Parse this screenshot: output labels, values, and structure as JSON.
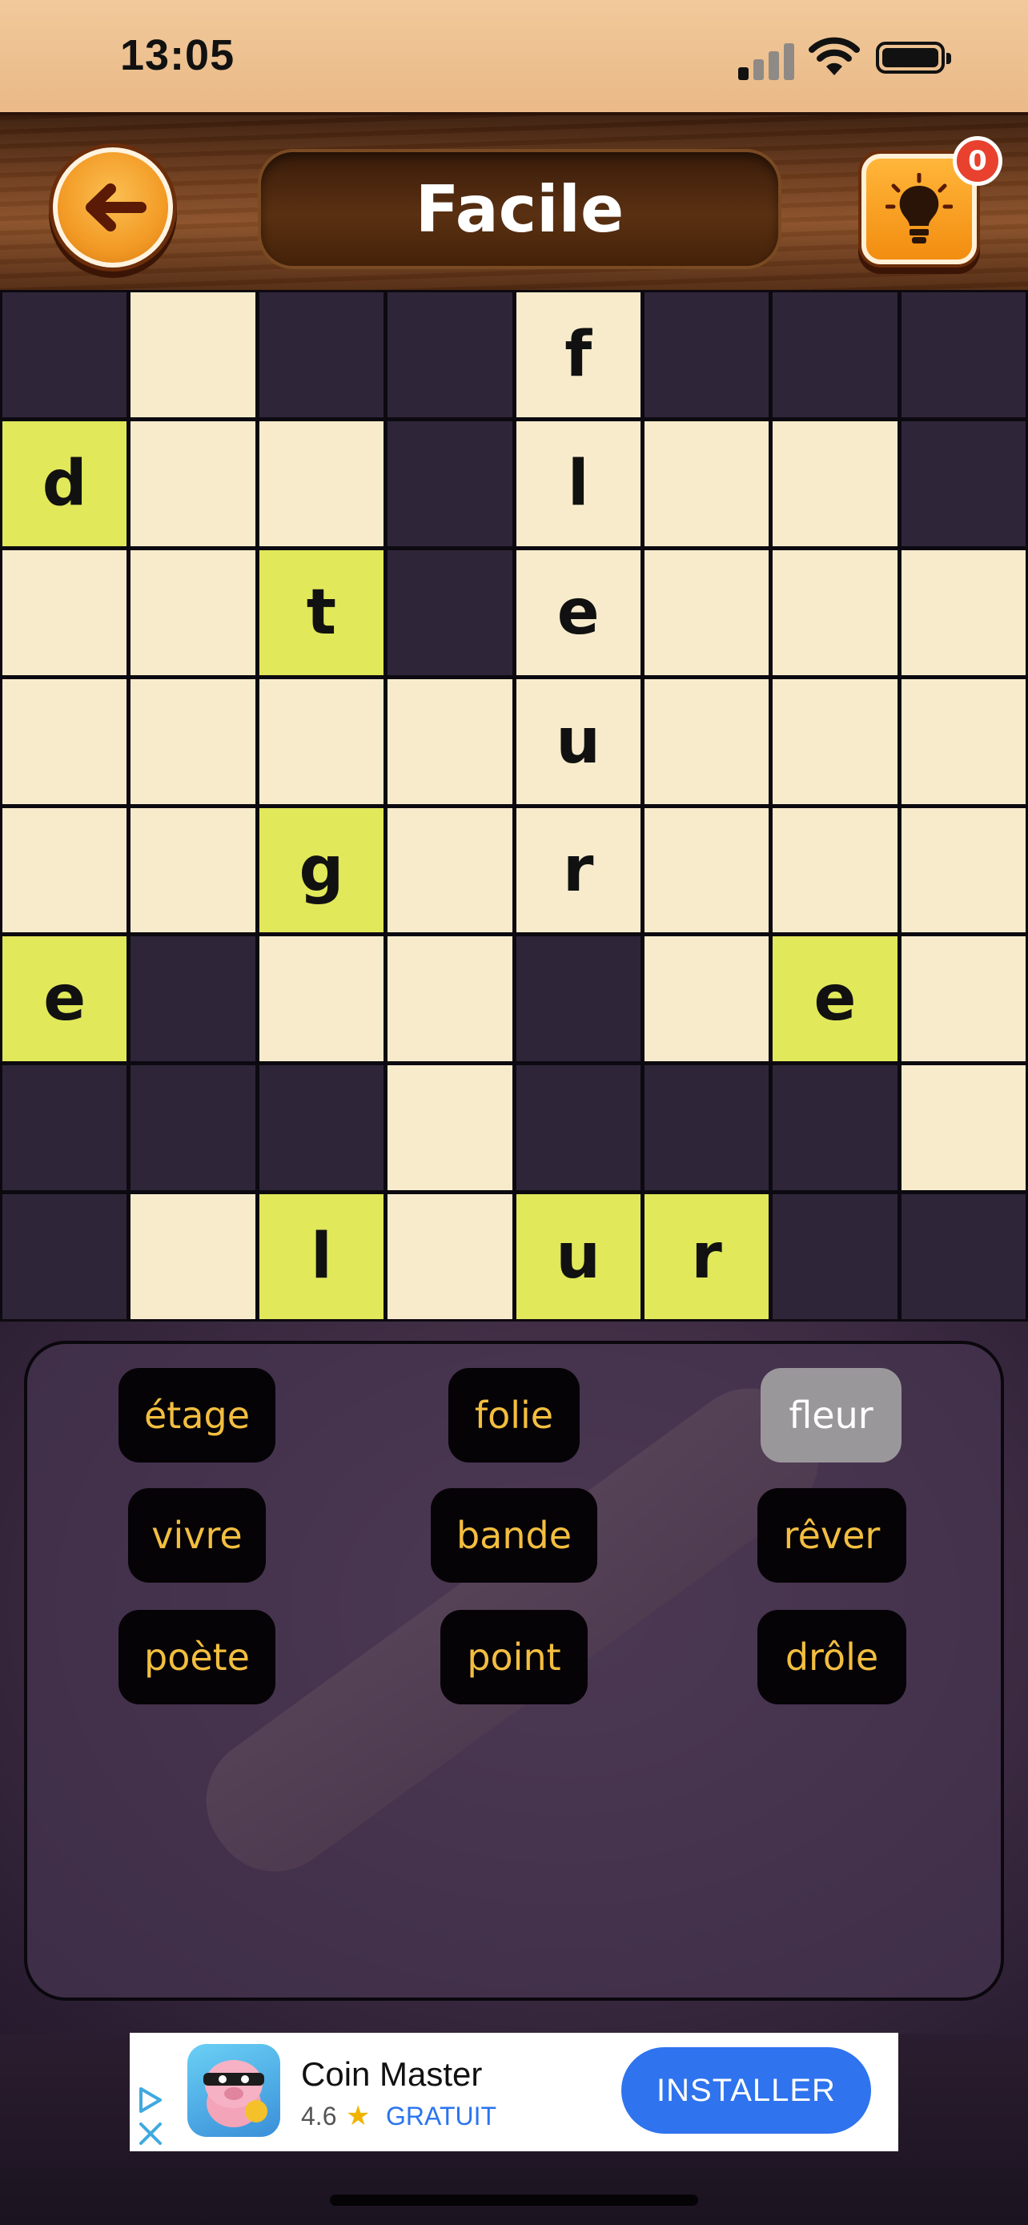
{
  "status_bar": {
    "time": "13:05"
  },
  "header": {
    "title": "Facile",
    "hint_count": "0"
  },
  "grid": {
    "rows": [
      [
        {
          "t": "dark",
          "l": ""
        },
        {
          "t": "light",
          "l": ""
        },
        {
          "t": "dark",
          "l": ""
        },
        {
          "t": "dark",
          "l": ""
        },
        {
          "t": "light",
          "l": "f"
        },
        {
          "t": "dark",
          "l": ""
        },
        {
          "t": "dark",
          "l": ""
        },
        {
          "t": "dark",
          "l": ""
        }
      ],
      [
        {
          "t": "yellow",
          "l": "d"
        },
        {
          "t": "light",
          "l": ""
        },
        {
          "t": "light",
          "l": ""
        },
        {
          "t": "dark",
          "l": ""
        },
        {
          "t": "light",
          "l": "l"
        },
        {
          "t": "light",
          "l": ""
        },
        {
          "t": "light",
          "l": ""
        },
        {
          "t": "dark",
          "l": ""
        }
      ],
      [
        {
          "t": "light",
          "l": ""
        },
        {
          "t": "light",
          "l": ""
        },
        {
          "t": "yellow",
          "l": "t"
        },
        {
          "t": "dark",
          "l": ""
        },
        {
          "t": "light",
          "l": "e"
        },
        {
          "t": "light",
          "l": ""
        },
        {
          "t": "light",
          "l": ""
        },
        {
          "t": "light",
          "l": ""
        }
      ],
      [
        {
          "t": "light",
          "l": ""
        },
        {
          "t": "light",
          "l": ""
        },
        {
          "t": "light",
          "l": ""
        },
        {
          "t": "light",
          "l": ""
        },
        {
          "t": "light",
          "l": "u"
        },
        {
          "t": "light",
          "l": ""
        },
        {
          "t": "light",
          "l": ""
        },
        {
          "t": "light",
          "l": ""
        }
      ],
      [
        {
          "t": "light",
          "l": ""
        },
        {
          "t": "light",
          "l": ""
        },
        {
          "t": "yellow",
          "l": "g"
        },
        {
          "t": "light",
          "l": ""
        },
        {
          "t": "light",
          "l": "r"
        },
        {
          "t": "light",
          "l": ""
        },
        {
          "t": "light",
          "l": ""
        },
        {
          "t": "light",
          "l": ""
        }
      ],
      [
        {
          "t": "yellow",
          "l": "e"
        },
        {
          "t": "dark",
          "l": ""
        },
        {
          "t": "light",
          "l": ""
        },
        {
          "t": "light",
          "l": ""
        },
        {
          "t": "dark",
          "l": ""
        },
        {
          "t": "light",
          "l": ""
        },
        {
          "t": "yellow",
          "l": "e"
        },
        {
          "t": "light",
          "l": ""
        }
      ],
      [
        {
          "t": "dark",
          "l": ""
        },
        {
          "t": "dark",
          "l": ""
        },
        {
          "t": "dark",
          "l": ""
        },
        {
          "t": "light",
          "l": ""
        },
        {
          "t": "dark",
          "l": ""
        },
        {
          "t": "dark",
          "l": ""
        },
        {
          "t": "dark",
          "l": ""
        },
        {
          "t": "light",
          "l": ""
        }
      ],
      [
        {
          "t": "dark",
          "l": ""
        },
        {
          "t": "light",
          "l": ""
        },
        {
          "t": "yellow",
          "l": "l"
        },
        {
          "t": "light",
          "l": ""
        },
        {
          "t": "yellow",
          "l": "u"
        },
        {
          "t": "yellow",
          "l": "r"
        },
        {
          "t": "dark",
          "l": ""
        },
        {
          "t": "dark",
          "l": ""
        }
      ]
    ]
  },
  "words": [
    {
      "label": "étage",
      "found": false
    },
    {
      "label": "folie",
      "found": false
    },
    {
      "label": "fleur",
      "found": true
    },
    {
      "label": "vivre",
      "found": false
    },
    {
      "label": "bande",
      "found": false
    },
    {
      "label": "rêver",
      "found": false
    },
    {
      "label": "poète",
      "found": false
    },
    {
      "label": "point",
      "found": false
    },
    {
      "label": "drôle",
      "found": false
    }
  ],
  "ad": {
    "app_name": "Coin Master",
    "rating": "4.6",
    "price": "GRATUIT",
    "install_label": "INSTALLER"
  },
  "colors": {
    "dark_cell": "#2f2539",
    "light_cell": "#f7ebcc",
    "highlight_cell": "#e1e85a",
    "word_text": "#f3be3f",
    "found_chip": "#9a979b",
    "install_blue": "#2f73ee"
  }
}
